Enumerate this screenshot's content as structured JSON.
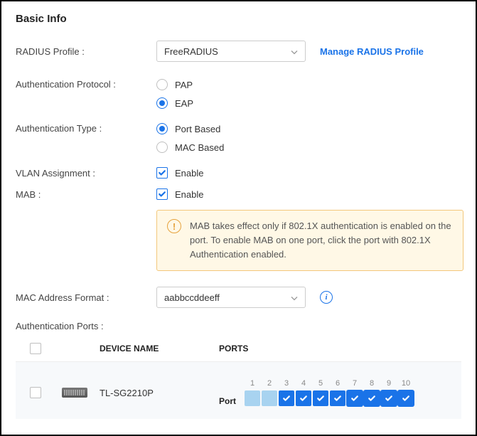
{
  "section_title": "Basic Info",
  "radius_profile": {
    "label": "RADIUS Profile :",
    "value": "FreeRADIUS",
    "manage_link": "Manage RADIUS Profile"
  },
  "auth_protocol": {
    "label": "Authentication Protocol :",
    "options": [
      {
        "label": "PAP",
        "checked": false
      },
      {
        "label": "EAP",
        "checked": true
      }
    ]
  },
  "auth_type": {
    "label": "Authentication Type :",
    "options": [
      {
        "label": "Port Based",
        "checked": true
      },
      {
        "label": "MAC Based",
        "checked": false
      }
    ]
  },
  "vlan_assignment": {
    "label": "VLAN Assignment :",
    "option_label": "Enable",
    "checked": true
  },
  "mab": {
    "label": "MAB :",
    "option_label": "Enable",
    "checked": true
  },
  "alert_text": "MAB takes effect only if 802.1X authentication is enabled on the port. To enable MAB on one port, click the port with 802.1X Authentication enabled.",
  "mac_format": {
    "label": "MAC Address Format :",
    "value": "aabbccddeeff"
  },
  "auth_ports_label": "Authentication Ports :",
  "table": {
    "headers": {
      "device_name": "DEVICE NAME",
      "ports": "PORTS"
    },
    "row": {
      "device_name": "TL-SG2210P",
      "port_type_label": "Port",
      "ports": [
        {
          "n": "1",
          "state": "solid",
          "outlined": false
        },
        {
          "n": "2",
          "state": "solid",
          "outlined": false
        },
        {
          "n": "3",
          "state": "checked",
          "outlined": false
        },
        {
          "n": "4",
          "state": "checked",
          "outlined": false
        },
        {
          "n": "5",
          "state": "checked",
          "outlined": false
        },
        {
          "n": "6",
          "state": "checked",
          "outlined": false
        },
        {
          "n": "7",
          "state": "checked",
          "outlined": true
        },
        {
          "n": "8",
          "state": "checked",
          "outlined": true
        },
        {
          "n": "9",
          "state": "checked",
          "outlined": true
        },
        {
          "n": "10",
          "state": "checked",
          "outlined": true
        }
      ]
    }
  }
}
